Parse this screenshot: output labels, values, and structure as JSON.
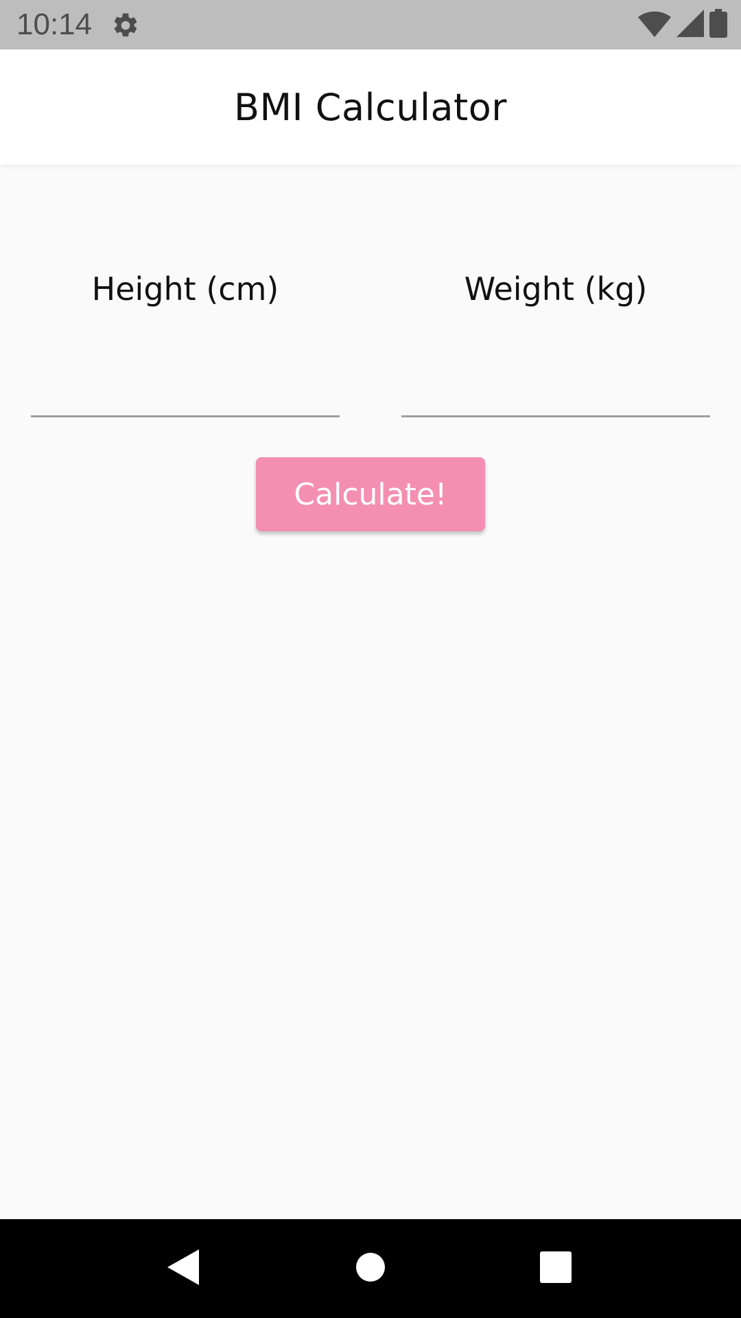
{
  "status_bar": {
    "time": "10:14",
    "icons": [
      "settings-gear-icon",
      "wifi-icon",
      "cell-signal-icon",
      "battery-icon"
    ]
  },
  "app_bar": {
    "title": "BMI Calculator"
  },
  "form": {
    "height": {
      "label": "Height (cm)",
      "value": "",
      "placeholder": ""
    },
    "weight": {
      "label": "Weight (kg)",
      "value": "",
      "placeholder": ""
    },
    "calculate_label": "Calculate!"
  },
  "nav_bar": {
    "buttons": [
      "back-icon",
      "home-icon",
      "recents-icon"
    ]
  },
  "colors": {
    "status_bar": "#bdbdbd",
    "app_bar": "#ffffff",
    "background": "#fafafa",
    "button": "#f48fb1",
    "button_text": "#ffffff",
    "underline": "#9e9e9e",
    "nav_bar": "#000000"
  }
}
